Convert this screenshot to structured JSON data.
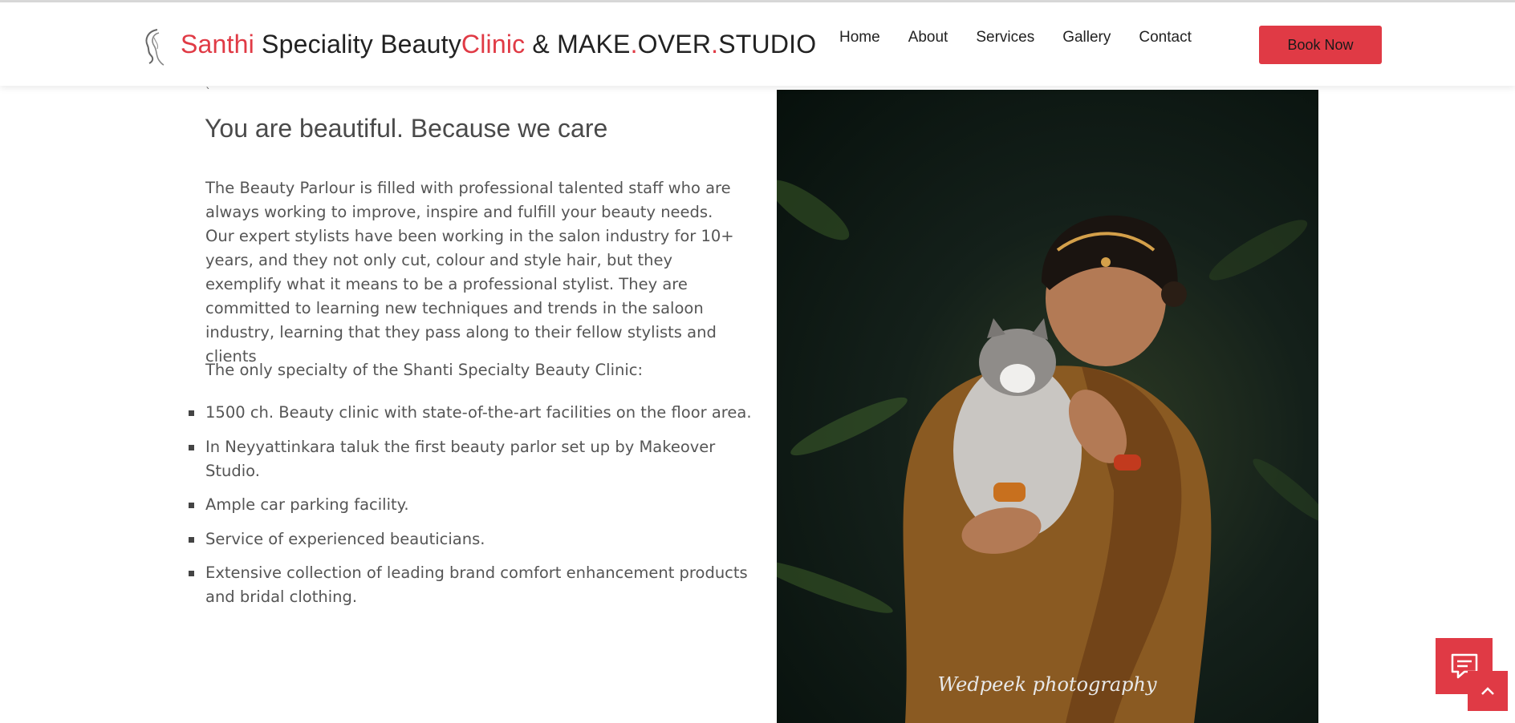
{
  "header": {
    "brand": {
      "part1": "Santhi",
      "part2": " Speciality Beauty",
      "part3": "Clinic",
      "part4": " & MAKE",
      "dot1": ".",
      "part5": "OVER",
      "dot2": ".",
      "part6": "STUDIO"
    },
    "nav": [
      "Home",
      "About",
      "Services",
      "Gallery",
      "Contact"
    ],
    "book_label": "Book Now"
  },
  "main": {
    "tick": "`",
    "title": "You are beautiful. Because we care",
    "paragraph": "The Beauty Parlour is filled with professional talented staff who are always working to improve, inspire and fulfill your beauty needs. Our expert stylists have been working in the salon industry for 10+ years, and they not only cut, colour and style hair, but they exemplify what it means to be a professional stylist. They are committed to learning new techniques and trends in the saloon industry, learning that they pass along to their fellow stylists and clients",
    "specialty_intro": "The only specialty of the Shanti Specialty Beauty Clinic:",
    "features": [
      "1500 ch. Beauty clinic with state-of-the-art facilities on the floor area.",
      "In Neyyattinkara taluk the first beauty parlor set up by Makeover Studio.",
      "Ample car parking facility.",
      "Service of experienced beauticians.",
      "Extensive collection of leading brand comfort enhancement products and bridal clothing."
    ],
    "photo_watermark": "Wedpeek photography"
  },
  "widgets": {
    "chat_icon": "chat-bubble-icon",
    "scroll_top_icon": "chevron-up-icon"
  },
  "colors": {
    "accent": "#e03a45",
    "text": "#555555",
    "heading": "#4a4a4a"
  }
}
